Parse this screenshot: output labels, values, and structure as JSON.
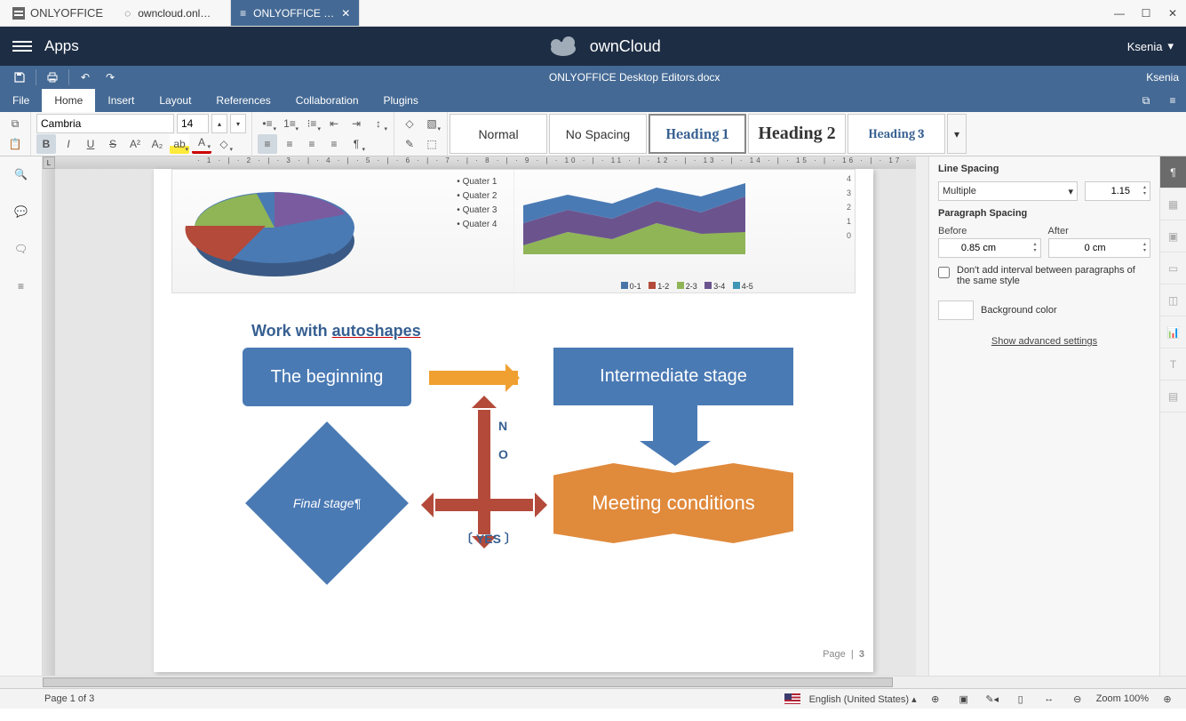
{
  "titlebar": {
    "logo": "ONLYOFFICE",
    "tabs": [
      {
        "label": "owncloud.onl…",
        "active": false
      },
      {
        "label": "ONLYOFFICE …",
        "active": true
      }
    ]
  },
  "owncloud": {
    "apps": "Apps",
    "brand": "ownCloud",
    "user": "Ksenia"
  },
  "quickaccess": {
    "doc_title": "ONLYOFFICE Desktop Editors.docx",
    "user": "Ksenia"
  },
  "menu": {
    "items": [
      "File",
      "Home",
      "Insert",
      "Layout",
      "References",
      "Collaboration",
      "Plugins"
    ],
    "active_index": 1
  },
  "ribbon": {
    "font_name": "Cambria",
    "font_size": "14",
    "styles": [
      "Normal",
      "No Spacing",
      "Heading 1",
      "Heading 2",
      "Heading 3"
    ],
    "style_selected_index": 2
  },
  "ruler": "· 1 · | · 2 · | · 3 · | · 4 · | · 5 · | · 6 · | · 7 · | · 8 · | · 9 · | · 10 · | · 11 · | · 12 · | · 13 · | · 14 · | · 15 · | · 16 · | · 17 ·",
  "document": {
    "pie_legend": [
      "Quater 1",
      "Quater 2",
      "Quater 3",
      "Quater 4"
    ],
    "area_yaxis": [
      "4",
      "3",
      "2",
      "1",
      "0"
    ],
    "area_legend": [
      {
        "label": "0-1",
        "color": "#4a74a8"
      },
      {
        "label": "1-2",
        "color": "#b34a3a"
      },
      {
        "label": "2-3",
        "color": "#8fb556"
      },
      {
        "label": "3-4",
        "color": "#6b548e"
      },
      {
        "label": "4-5",
        "color": "#3e97b5"
      }
    ],
    "section_title_a": "Work with ",
    "section_title_b": "autoshapes",
    "shape_beginning": "The beginning",
    "shape_intermediate": "Intermediate stage",
    "shape_final": "Final stage¶",
    "shape_meeting": "Meeting conditions",
    "label_no_1": "N",
    "label_no_2": "O",
    "label_yes": "YES",
    "page_footer_a": "Page",
    "page_footer_b": "3"
  },
  "right_panel": {
    "line_spacing_label": "Line Spacing",
    "line_spacing_mode": "Multiple",
    "line_spacing_value": "1.15",
    "para_spacing_label": "Paragraph Spacing",
    "before_label": "Before",
    "after_label": "After",
    "before_value": "0.85 cm",
    "after_value": "0 cm",
    "dont_add_label": "Don't add interval between paragraphs of the same style",
    "bg_color_label": "Background color",
    "advanced_label": "Show advanced settings"
  },
  "statusbar": {
    "page_info": "Page 1 of 3",
    "language": "English (United States)",
    "zoom_label": "Zoom 100%"
  }
}
